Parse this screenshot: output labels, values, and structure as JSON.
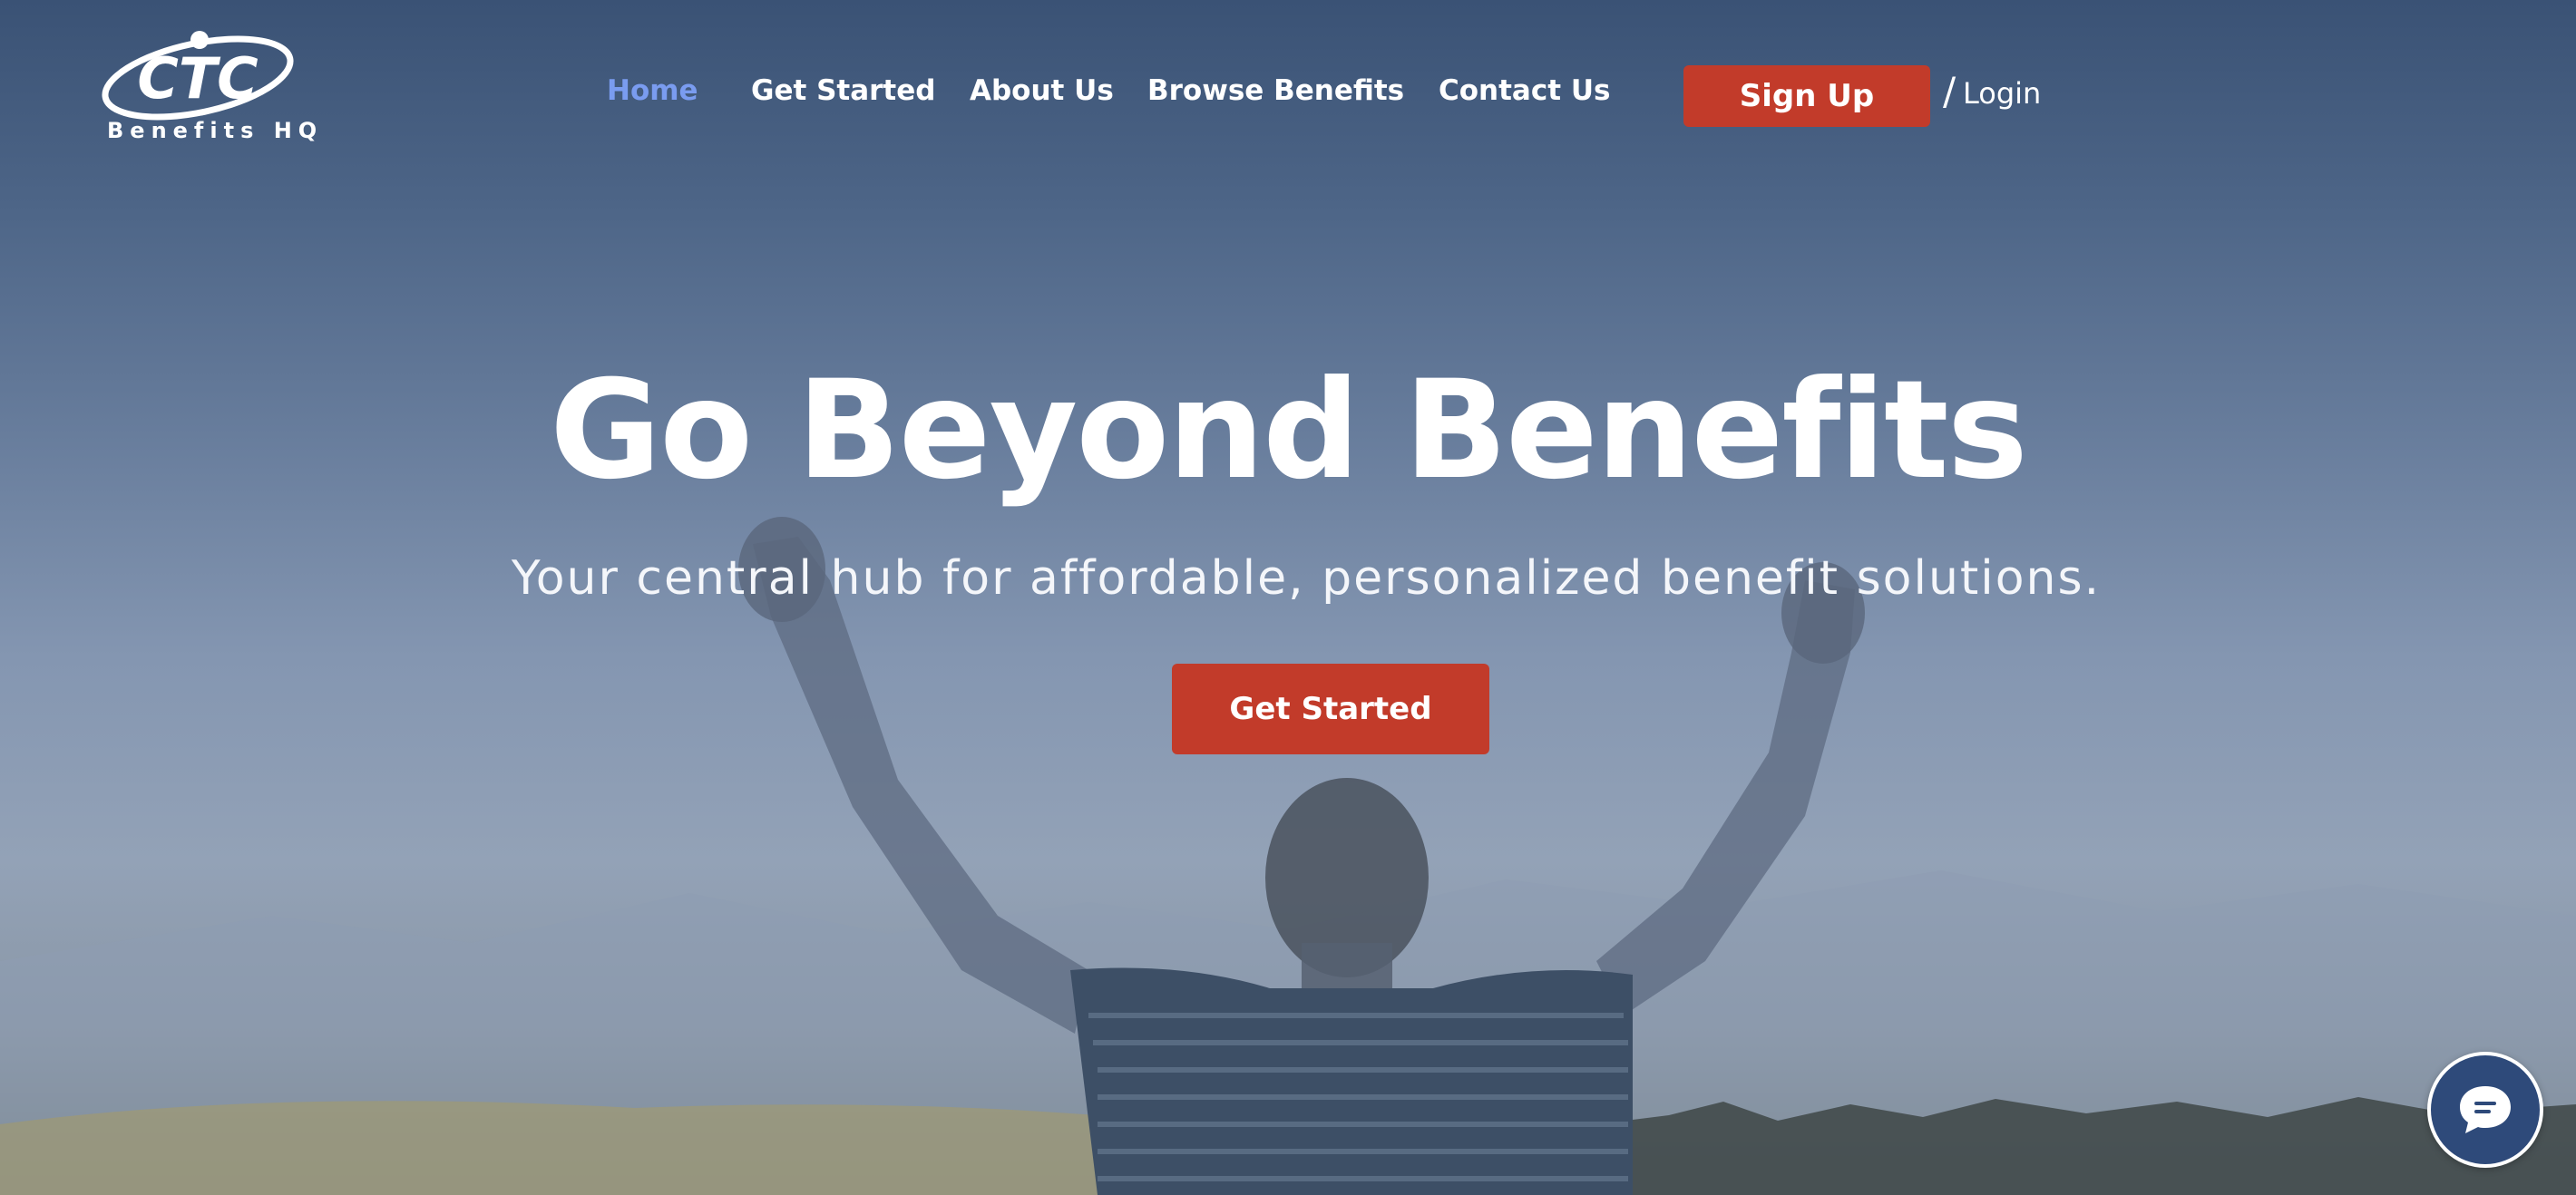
{
  "logo": {
    "mark_text": "CTC",
    "subtitle": "Benefits HQ"
  },
  "nav": {
    "items": [
      {
        "label": "Home",
        "active": true
      },
      {
        "label": "Get Started",
        "active": false
      },
      {
        "label": "About Us",
        "active": false
      },
      {
        "label": "Browse Benefits",
        "active": false
      },
      {
        "label": "Contact Us",
        "active": false
      }
    ],
    "signup_label": "Sign Up",
    "login_separator": "/",
    "login_label": "Login"
  },
  "hero": {
    "headline": "Go Beyond Benefits",
    "subheadline": "Your central hub for affordable, personalized benefit solutions.",
    "cta_label": "Get Started"
  },
  "chat": {
    "icon": "chat-bubble-icon"
  },
  "colors": {
    "accent_red": "#c23b2a",
    "nav_active": "#7a9cf0",
    "chat_bg": "#2e4a7a",
    "overlay_top": "#3a5275"
  }
}
